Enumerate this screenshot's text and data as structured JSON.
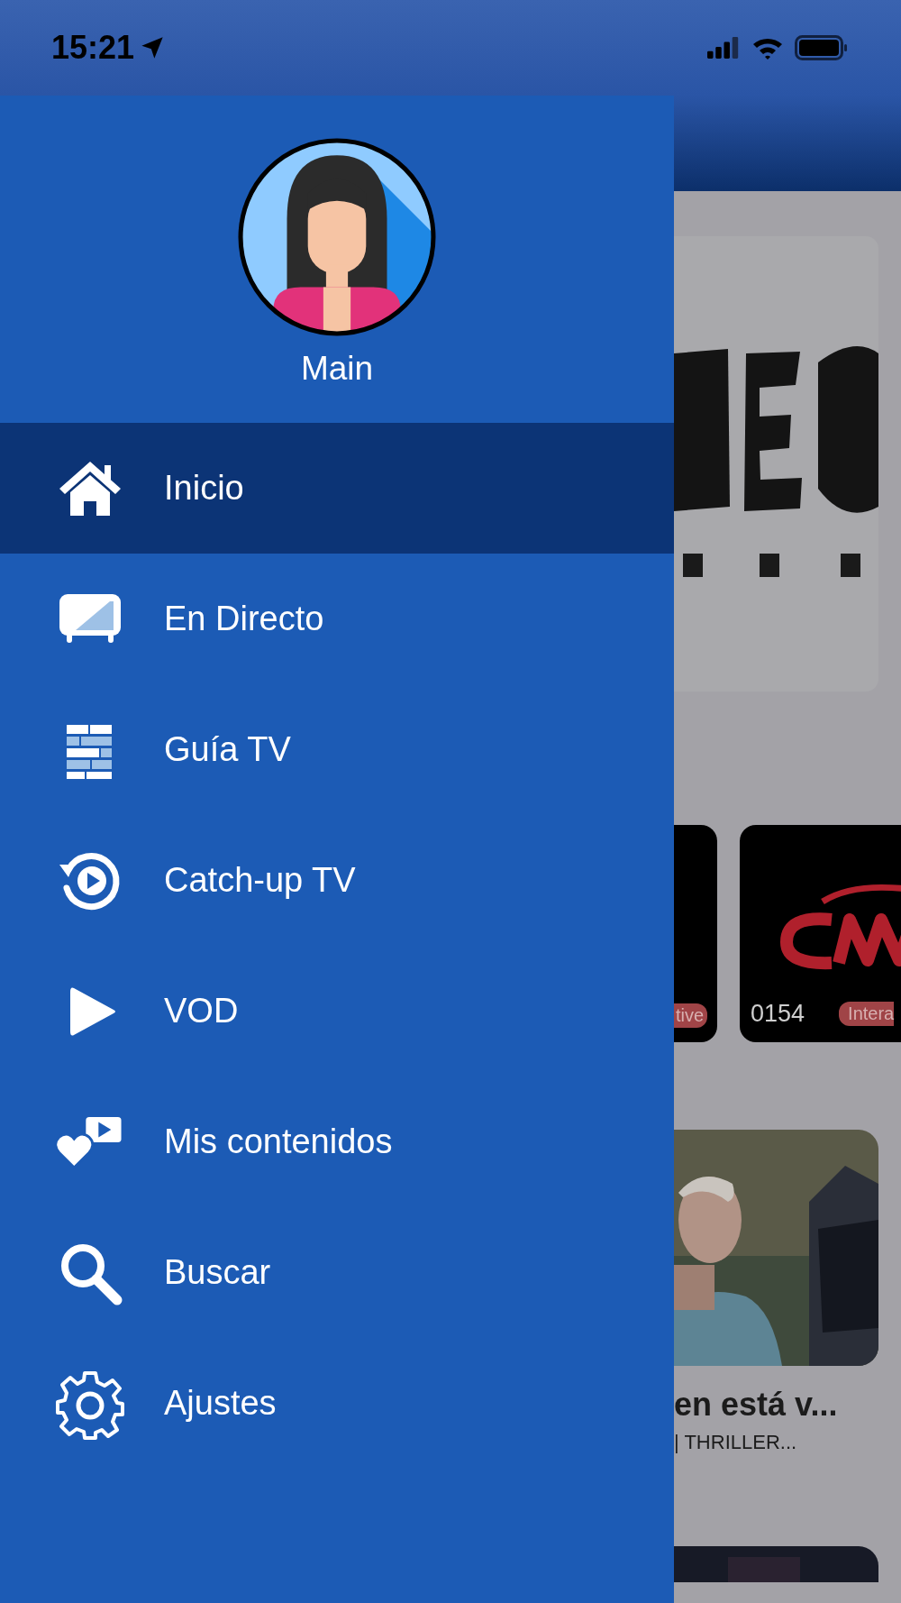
{
  "status_bar": {
    "time": "15:21"
  },
  "drawer": {
    "profile": {
      "name": "Main"
    },
    "items": [
      {
        "label": "Inicio",
        "selected": true
      },
      {
        "label": "En Directo",
        "selected": false
      },
      {
        "label": "Guía TV",
        "selected": false
      },
      {
        "label": "Catch-up TV",
        "selected": false
      },
      {
        "label": "VOD",
        "selected": false
      },
      {
        "label": "Mis contenidos",
        "selected": false
      },
      {
        "label": "Buscar",
        "selected": false
      },
      {
        "label": "Ajustes",
        "selected": false
      }
    ]
  },
  "background": {
    "channels": [
      {
        "badge": "tive"
      },
      {
        "number": "0154",
        "badge": "Intera"
      }
    ],
    "movie": {
      "title": "en está v...",
      "subtitle": "| THRILLER..."
    }
  }
}
